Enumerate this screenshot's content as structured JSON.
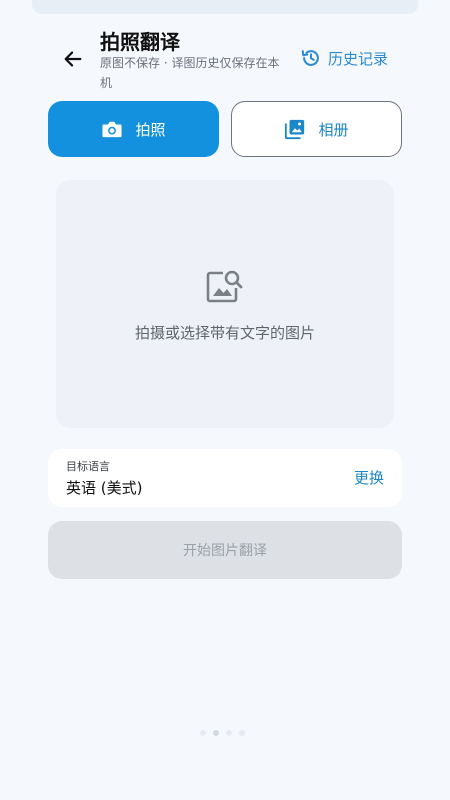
{
  "header": {
    "title": "拍照翻译",
    "subtitle": "原图不保存 · 译图历史仅保存在本机",
    "history_label": "历史记录"
  },
  "modes": {
    "camera_label": "拍照",
    "album_label": "相册"
  },
  "drop_area": {
    "hint": "拍摄或选择带有文字的图片"
  },
  "language": {
    "label": "目标语言",
    "value": "英语 (美式)",
    "change_label": "更换"
  },
  "start_button": {
    "label": "开始图片翻译",
    "enabled": false
  },
  "pager": {
    "count": 4,
    "active_index": 1
  },
  "colors": {
    "accent": "#1491de",
    "link": "#1b86c8",
    "background": "#f5f8fd",
    "disabled": "#dde1e6"
  },
  "icons": {
    "back": "arrow-left-icon",
    "history": "history-clock-icon",
    "camera": "camera-icon",
    "album": "image-gallery-icon",
    "drop": "image-search-icon"
  }
}
